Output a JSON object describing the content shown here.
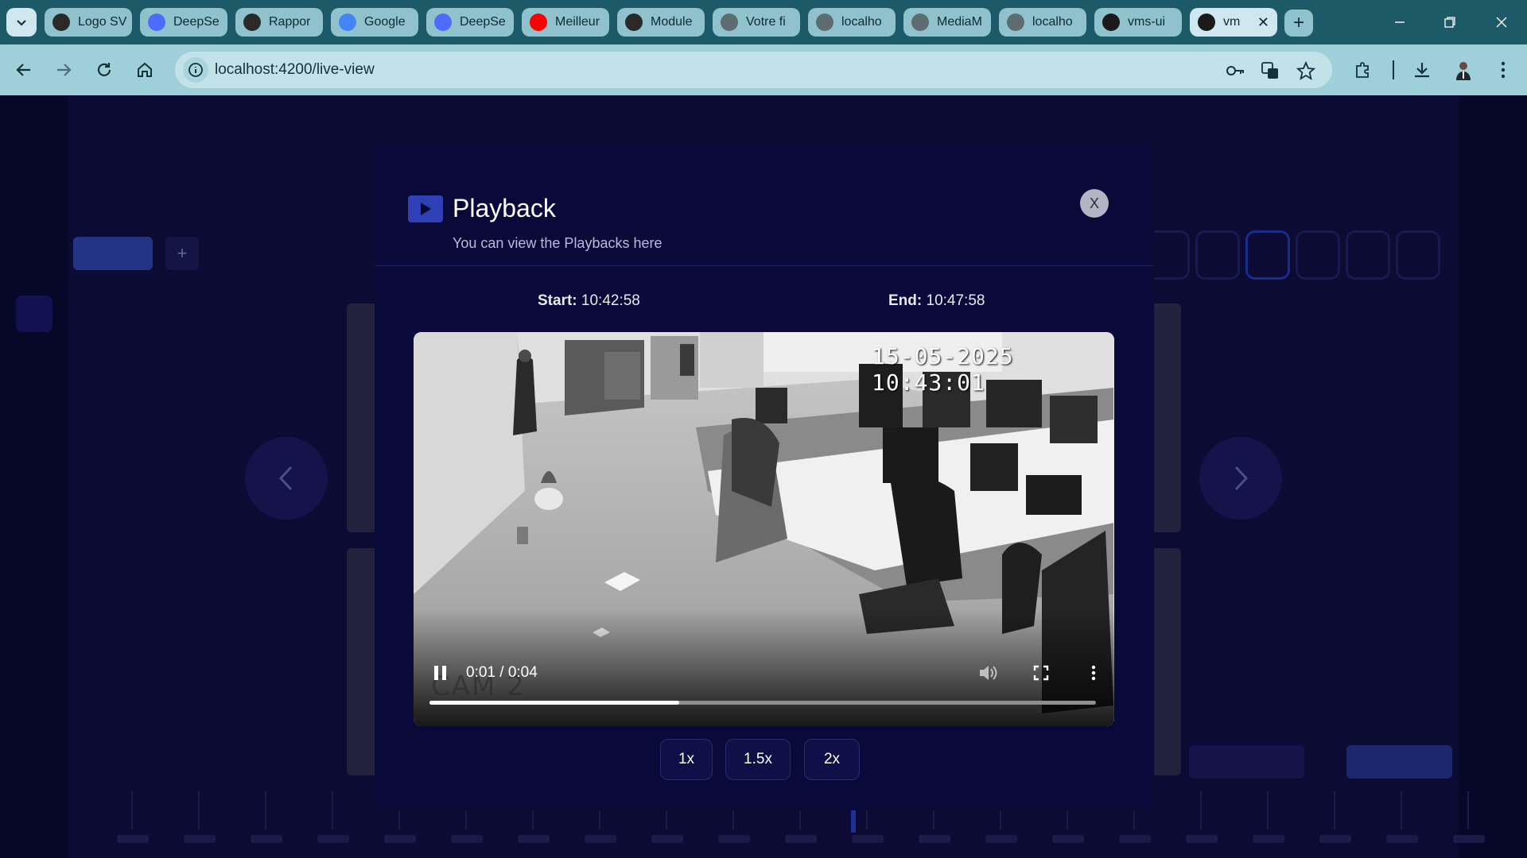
{
  "browser": {
    "tabs": [
      {
        "title": "Logo SV",
        "favicon": "openai-icon",
        "color": "#2a2a2a"
      },
      {
        "title": "DeepSe",
        "favicon": "deepseek-icon",
        "color": "#4d6bfe"
      },
      {
        "title": "Rappor",
        "favicon": "openai-icon",
        "color": "#2a2a2a"
      },
      {
        "title": "Google",
        "favicon": "google-translate-icon",
        "color": "#4285f4"
      },
      {
        "title": "DeepSe",
        "favicon": "deepseek-icon",
        "color": "#4d6bfe"
      },
      {
        "title": "Meilleur",
        "favicon": "youtube-icon",
        "color": "#ff0000"
      },
      {
        "title": "Module",
        "favicon": "openai-icon",
        "color": "#2a2a2a"
      },
      {
        "title": "Votre fi",
        "favicon": "globe-icon",
        "color": "#5c6c70"
      },
      {
        "title": "localho",
        "favicon": "globe-icon",
        "color": "#5c6c70"
      },
      {
        "title": "MediaM",
        "favicon": "globe-icon",
        "color": "#5c6c70"
      },
      {
        "title": "localho",
        "favicon": "globe-icon",
        "color": "#5c6c70"
      },
      {
        "title": "vms-ui",
        "favicon": "angular-icon",
        "color": "#1a1a1a"
      },
      {
        "title": "vm",
        "favicon": "angular-icon",
        "color": "#1a1a1a",
        "active": true
      }
    ],
    "url": "localhost:4200/live-view"
  },
  "modal": {
    "title": "Playback",
    "subtitle": "You can view the Playbacks here",
    "close_label": "X",
    "start_label": "Start:",
    "start_time": "10:42:58",
    "end_label": "End:",
    "end_time": "10:47:58"
  },
  "video": {
    "time_display": "0:01 / 0:04",
    "progress": 0.375,
    "osd_timestamp": "15-05-2025 10:43:01",
    "osd_camera": "CAM 2"
  },
  "speeds": [
    "1x",
    "1.5x",
    "2x"
  ],
  "colors": {
    "modal_bg": "#09093a",
    "accent": "#2f3fb5",
    "page_bg": "#07072a"
  }
}
